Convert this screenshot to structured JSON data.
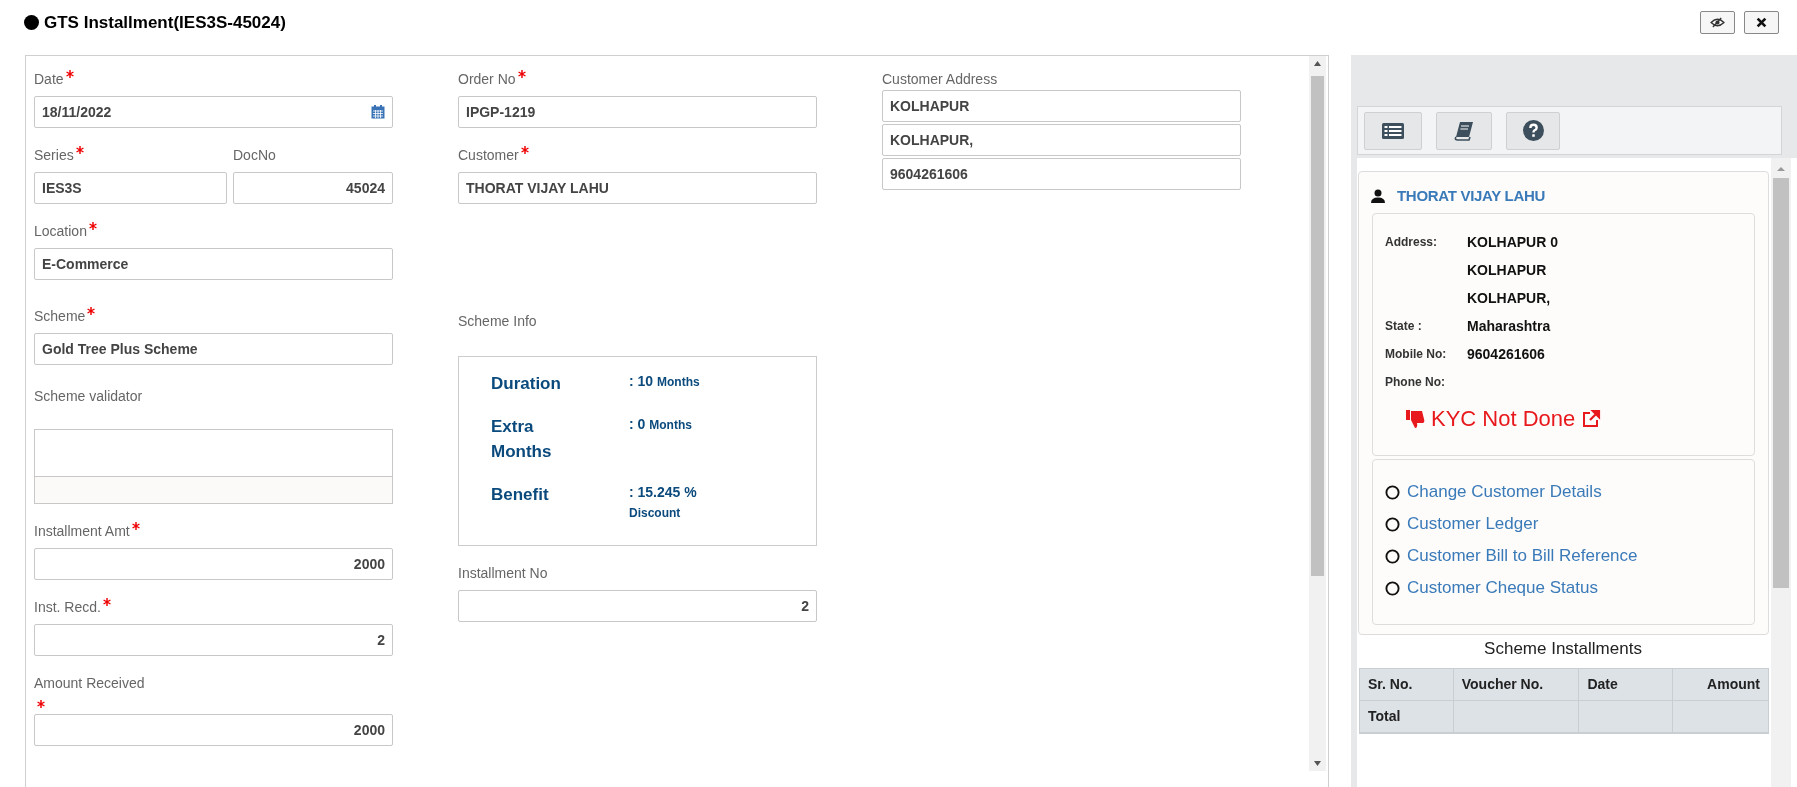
{
  "title": "GTS Installment(IES3S-45024)",
  "header_buttons": [
    {
      "kind": "hide"
    },
    {
      "kind": "close"
    }
  ],
  "form": {
    "date": {
      "label": "Date",
      "required": true,
      "value": "18/11/2022"
    },
    "series": {
      "label": "Series",
      "required": true,
      "value": "IES3S"
    },
    "doc_no": {
      "label": "DocNo",
      "value": "45024"
    },
    "location": {
      "label": "Location",
      "required": true,
      "value": "E-Commerce"
    },
    "scheme": {
      "label": "Scheme",
      "required": true,
      "value": "Gold Tree Plus Scheme"
    },
    "scheme_validator": {
      "label": "Scheme validator"
    },
    "installment_amt": {
      "label": "Installment Amt",
      "required": true,
      "value": "2000"
    },
    "inst_recd": {
      "label": "Inst. Recd.",
      "required": true,
      "value": "2"
    },
    "amount_received": {
      "label": "Amount Received",
      "required": true,
      "value": "2000"
    },
    "order_no": {
      "label": "Order No",
      "required": true,
      "value": "IPGP-1219"
    },
    "customer": {
      "label": "Customer",
      "required": true,
      "value": "THORAT VIJAY LAHU"
    },
    "scheme_info": {
      "label": "Scheme Info",
      "rows": [
        {
          "label": "Duration",
          "value": ": 10",
          "unit": "Months"
        },
        {
          "label": "Extra Months",
          "value": ": 0",
          "unit": "Months"
        },
        {
          "label": "Benefit",
          "value": ": 15.245 %",
          "unit": "Discount"
        }
      ]
    },
    "installment_no": {
      "label": "Installment No",
      "value": "2"
    },
    "customer_address": {
      "label": "Customer Address",
      "lines": [
        "KOLHAPUR",
        "KOLHAPUR,",
        "9604261606"
      ]
    }
  },
  "side_panel": {
    "tool_buttons": [
      {
        "kind": "list"
      },
      {
        "kind": "book"
      },
      {
        "kind": "help"
      }
    ],
    "customer_name": "THORAT VIJAY LAHU",
    "details": [
      {
        "label": "Address:",
        "values": [
          "KOLHAPUR 0",
          "KOLHAPUR",
          "KOLHAPUR,"
        ]
      },
      {
        "label": "State :",
        "values": [
          "Maharashtra"
        ]
      },
      {
        "label": "Mobile No:",
        "values": [
          "9604261606"
        ]
      },
      {
        "label": "Phone No:"
      }
    ],
    "kyc": {
      "text": "KYC Not Done",
      "done": false
    },
    "links": [
      {
        "label": "Change Customer Details",
        "selected": false
      },
      {
        "label": "Customer Ledger",
        "selected": false
      },
      {
        "label": "Customer Bill to Bill Reference",
        "selected": false
      },
      {
        "label": "Customer Cheque Status",
        "selected": false
      }
    ],
    "installments": {
      "title": "Scheme Installments",
      "columns": [
        "Sr. No.",
        "Voucher No.",
        "Date",
        "Amount"
      ],
      "footer": "Total"
    }
  }
}
